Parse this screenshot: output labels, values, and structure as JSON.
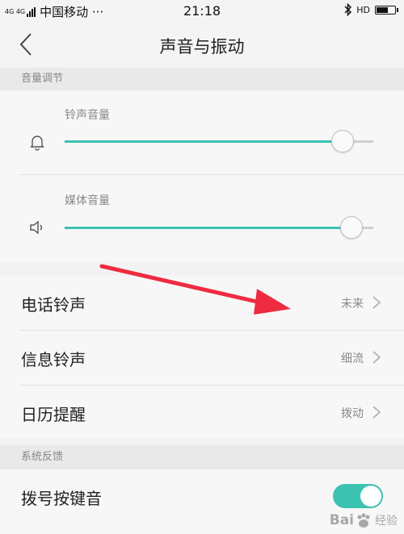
{
  "status_bar": {
    "network": "4G 4G",
    "carrier": "中国移动 ···",
    "time": "21:18",
    "right_icons": [
      "bluetooth-icon",
      "hd-icon",
      "battery-icon"
    ],
    "hd_label": "HD"
  },
  "nav": {
    "title": "声音与振动",
    "back_icon": "back-chevron-icon"
  },
  "volume_section": {
    "header": "音量调节",
    "ringtone": {
      "label": "铃声音量",
      "icon": "bell-icon",
      "level": 0.9
    },
    "media": {
      "label": "媒体音量",
      "icon": "speaker-icon",
      "level": 0.93
    }
  },
  "ringtone_rows": [
    {
      "label": "电话铃声",
      "value": "未来"
    },
    {
      "label": "信息铃声",
      "value": "细流"
    },
    {
      "label": "日历提醒",
      "value": "拨动"
    }
  ],
  "feedback_section": {
    "header": "系统反馈",
    "dial_tone": {
      "label": "拨号按键音",
      "enabled": true
    }
  },
  "watermark": {
    "text_en": "Bai",
    "text_cn": "经验"
  },
  "colors": {
    "accent": "#3cc2b1",
    "arrow": "#ee2b40"
  }
}
